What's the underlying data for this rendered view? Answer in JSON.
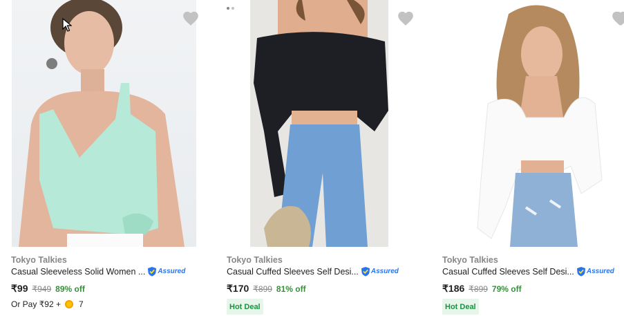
{
  "products": [
    {
      "brand": "Tokyo Talkies",
      "title": "Casual Sleeveless Solid Women ...",
      "assured": "Assured",
      "price": "₹99",
      "mrp": "₹949",
      "discount": "89% off",
      "or_pay_prefix": "Or Pay ₹92 +",
      "or_pay_coins": "7",
      "image_icon": "teal-camisole-photo",
      "wishlist_icon": "heart-icon"
    },
    {
      "brand": "Tokyo Talkies",
      "title": "Casual Cuffed Sleeves Self Desi...",
      "assured": "Assured",
      "price": "₹170",
      "mrp": "₹899",
      "discount": "81% off",
      "badge": "Hot Deal",
      "image_icon": "black-off-shoulder-top-photo",
      "wishlist_icon": "heart-icon"
    },
    {
      "brand": "Tokyo Talkies",
      "title": "Casual Cuffed Sleeves Self Desi...",
      "assured": "Assured",
      "price": "₹186",
      "mrp": "₹899",
      "discount": "79% off",
      "badge": "Hot Deal",
      "image_icon": "white-square-neck-top-photo",
      "wishlist_icon": "heart-icon"
    }
  ],
  "colors": {
    "brand_text": "#878787",
    "discount": "#388e3c",
    "assured_blue": "#2874f0",
    "hot_deal_bg": "#e7f6ea",
    "hot_deal_text": "#1c9140",
    "heart": "#c2c2c2"
  }
}
